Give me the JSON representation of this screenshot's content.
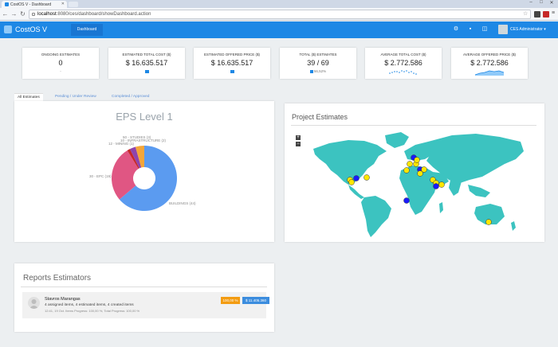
{
  "browser": {
    "tab_title": "CostOS V - Dashboard",
    "url_host": "localhost",
    "url_rest": ":8080/ces/dashboard/showDashboard.action"
  },
  "app": {
    "brand": "CostOS V",
    "nav_tab": "Dashboard",
    "user": "CES Administrator ▾"
  },
  "stats": [
    {
      "title": "ONGOING ESTIMATES",
      "value": "0",
      "sub": "-"
    },
    {
      "title": "ESTIMATED TOTAL COST ($)",
      "value": "$ 16.635.517",
      "sub": ""
    },
    {
      "title": "ESTIMATED OFFERED PRICE ($)",
      "value": "$ 16.635.517",
      "sub": ""
    },
    {
      "title": "TOTAL ($) ESTIMATES",
      "value": "39 / 69",
      "sub": "56,52%"
    },
    {
      "title": "AVERAGE TOTAL COST ($)",
      "value": "$ 2.772.586",
      "sub": ""
    },
    {
      "title": "AVERAGE OFFERED PRICE ($)",
      "value": "$ 2.772.586",
      "sub": ""
    }
  ],
  "tabs": [
    "All Estimates",
    "Pending / Under Review",
    "Completed / Approved"
  ],
  "eps": {
    "title": "EPS Level 1",
    "labels": {
      "buildings": "BUILDINGS (44)",
      "epc": "30 - EPC (19)",
      "top1": "10 - INFRASTRUCTURE (2)",
      "top2": "50 - STUDIES (3)",
      "top3": "12 - MINING (1)"
    }
  },
  "chart_data": {
    "type": "pie",
    "title": "EPS Level 1",
    "slices": [
      {
        "label": "BUILDINGS (44)",
        "value": 44,
        "color": "#5b9bf0"
      },
      {
        "label": "30 - EPC (19)",
        "value": 19,
        "color": "#e05683"
      },
      {
        "label": "12 - MINING (1)",
        "value": 1,
        "color": "#c62828"
      },
      {
        "label": "10 - INFRASTRUCTURE (2)",
        "value": 2,
        "color": "#8e44ad"
      },
      {
        "label": "50 - STUDIES (3)",
        "value": 3,
        "color": "#f4a63a"
      }
    ]
  },
  "map": {
    "title": "Project Estimates",
    "zoom_in": "+",
    "zoom_out": "−",
    "land_color": "#3cc3c0",
    "marker_yellow": "#ffe600",
    "marker_blue": "#1a1aff"
  },
  "reports": {
    "title": "Reports Estimators",
    "name": "Stavros Marangas",
    "desc": "4 assigned items, 4 estimated items, 4 created items",
    "meta": "12:41, 19 Oct. Items Progress: 100,00 %, Total Progress: 100,00 %",
    "badge_pct": "100,00 %",
    "badge_amount": "$ 11.405.360"
  }
}
